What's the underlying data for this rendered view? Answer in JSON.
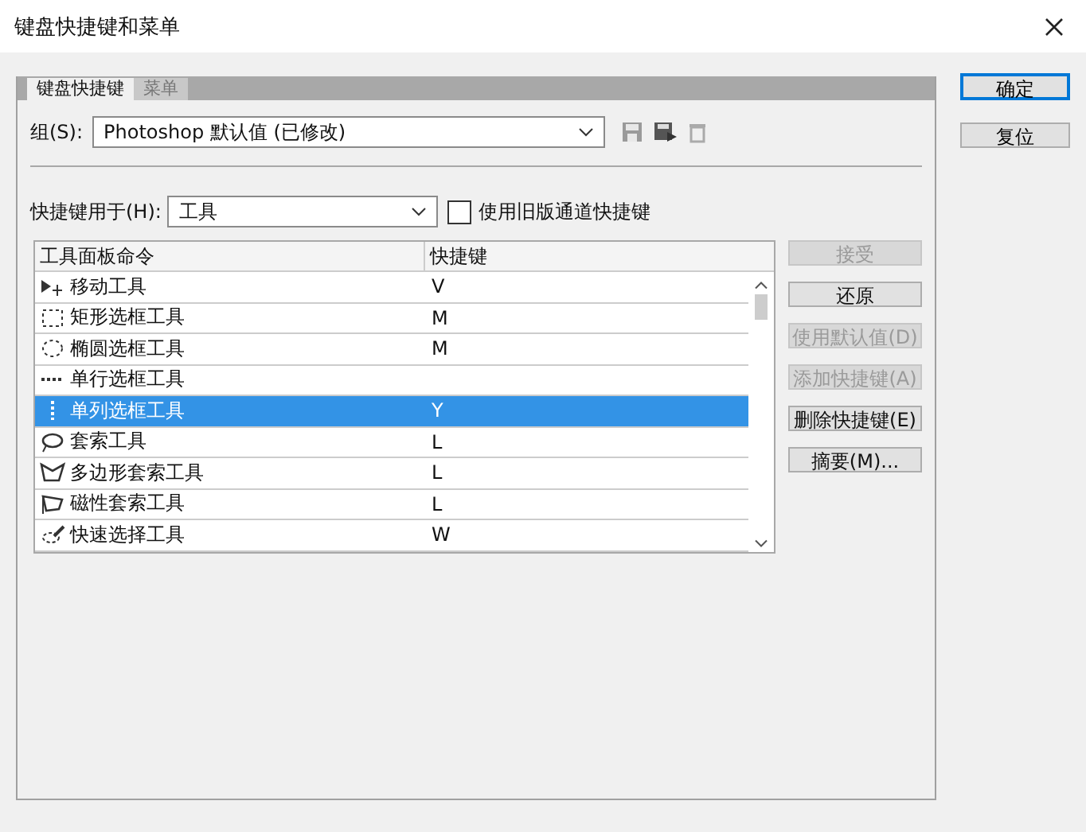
{
  "window": {
    "title": "键盘快捷键和菜单"
  },
  "tabs": [
    {
      "label": "键盘快捷键",
      "selected": true
    },
    {
      "label": "菜单",
      "selected": false
    }
  ],
  "set": {
    "label": "组(S):",
    "value": "Photoshop 默认值 (已修改)"
  },
  "shortcuts_for": {
    "label": "快捷键用于(H):",
    "value": "工具",
    "legacy_checkbox": {
      "label": "使用旧版通道快捷键",
      "checked": false
    }
  },
  "table": {
    "columns": [
      "工具面板命令",
      "快捷键"
    ],
    "rows": [
      {
        "command": "移动工具",
        "shortcut": "V",
        "selected": false
      },
      {
        "command": "矩形选框工具",
        "shortcut": "M",
        "selected": false
      },
      {
        "command": "椭圆选框工具",
        "shortcut": "M",
        "selected": false
      },
      {
        "command": "单行选框工具",
        "selected": false
      },
      {
        "command": "单列选框工具",
        "shortcut": "Y",
        "selected": true
      },
      {
        "command": "套索工具",
        "shortcut": "L",
        "selected": false
      },
      {
        "command": "多边形套索工具",
        "shortcut": "L",
        "selected": false
      },
      {
        "command": "磁性套索工具",
        "shortcut": "L",
        "selected": false
      },
      {
        "command": "快速选择工具",
        "shortcut": "W",
        "selected": false
      }
    ]
  },
  "side_buttons": [
    {
      "label": "接受",
      "disabled": true
    },
    {
      "label": "还原",
      "disabled": false
    },
    {
      "label": "使用默认值(D)",
      "disabled": true
    },
    {
      "label": "添加快捷键(A)",
      "disabled": true
    },
    {
      "label": "删除快捷键(E)",
      "disabled": false
    },
    {
      "label": "摘要(M)...",
      "disabled": false
    }
  ],
  "dialog_buttons": [
    "确定",
    "复位"
  ]
}
